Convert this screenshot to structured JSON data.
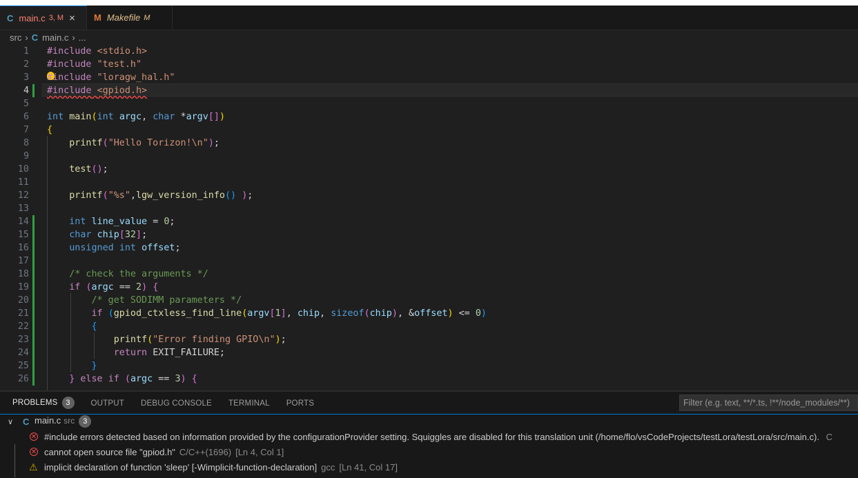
{
  "tabs": [
    {
      "icon": "C",
      "label": "main.c",
      "status": "3, M",
      "close": "×",
      "active": true
    },
    {
      "icon": "M",
      "label": "Makefile",
      "status": "M",
      "active": false
    }
  ],
  "breadcrumb": {
    "folder": "src",
    "icon": "C",
    "file": "main.c",
    "more": "..."
  },
  "editor": {
    "lines": [
      {
        "n": "1",
        "html": "<span class=\"p\">#include</span> <span class=\"s\">&lt;stdio.h&gt;</span>"
      },
      {
        "n": "2",
        "html": "<span class=\"p\">#include</span> <span class=\"s\">\"test.h\"</span>"
      },
      {
        "n": "3",
        "html": "<span class=\"p\">#include</span> <span class=\"s\">\"loragw_hal.h\"</span>"
      },
      {
        "n": "4",
        "html": "<span class=\"squiggle\"><span class=\"p\">#include</span> <span class=\"s\">&lt;gpiod.h&gt;</span></span>"
      },
      {
        "n": "5",
        "html": ""
      },
      {
        "n": "6",
        "html": "<span class=\"k\">int</span> <span class=\"f\">main</span><span class=\"b1\">(</span><span class=\"k\">int</span> <span class=\"v\">argc</span><span class=\"t\">, </span><span class=\"k\">char</span> <span class=\"t\">*</span><span class=\"v\">argv</span><span class=\"b2\">[]</span><span class=\"b1\">)</span>"
      },
      {
        "n": "7",
        "html": "<span class=\"b1\">{</span>"
      },
      {
        "n": "8",
        "html": "    <span class=\"f\">printf</span><span class=\"b2\">(</span><span class=\"s\">\"Hello Torizon!</span><span class=\"s\">\\n</span><span class=\"s\">\"</span><span class=\"b2\">)</span><span class=\"t\">;</span>"
      },
      {
        "n": "9",
        "html": ""
      },
      {
        "n": "10",
        "html": "    <span class=\"f\">test</span><span class=\"b2\">()</span><span class=\"t\">;</span>"
      },
      {
        "n": "11",
        "html": ""
      },
      {
        "n": "12",
        "html": "    <span class=\"f\">printf</span><span class=\"b2\">(</span><span class=\"s\">\"%s\"</span><span class=\"t\">,</span><span class=\"f\">lgw_version_info</span><span class=\"b3\">()</span> <span class=\"b2\">)</span><span class=\"t\">;</span>"
      },
      {
        "n": "13",
        "html": ""
      },
      {
        "n": "14",
        "html": "    <span class=\"k\">int</span> <span class=\"v\">line_value</span> <span class=\"t\">= </span><span class=\"n\">0</span><span class=\"t\">;</span>"
      },
      {
        "n": "15",
        "html": "    <span class=\"k\">char</span> <span class=\"v\">chip</span><span class=\"b2\">[</span><span class=\"n\">32</span><span class=\"b2\">]</span><span class=\"t\">;</span>"
      },
      {
        "n": "16",
        "html": "    <span class=\"k\">unsigned</span> <span class=\"k\">int</span> <span class=\"v\">offset</span><span class=\"t\">;</span>"
      },
      {
        "n": "17",
        "html": ""
      },
      {
        "n": "18",
        "html": "    <span class=\"c\">/* check the arguments */</span>"
      },
      {
        "n": "19",
        "html": "    <span class=\"p\">if</span> <span class=\"b2\">(</span><span class=\"v\">argc</span> <span class=\"t\">== </span><span class=\"n\">2</span><span class=\"b2\">)</span> <span class=\"b2\">{</span>"
      },
      {
        "n": "20",
        "html": "        <span class=\"c\">/* get SODIMM parameters */</span>"
      },
      {
        "n": "21",
        "html": "        <span class=\"p\">if</span> <span class=\"b3\">(</span><span class=\"f\">gpiod_ctxless_find_line</span><span class=\"b1\">(</span><span class=\"v\">argv</span><span class=\"b2\">[</span><span class=\"n\">1</span><span class=\"b2\">]</span><span class=\"t\">, </span><span class=\"v\">chip</span><span class=\"t\">, </span><span class=\"k\">sizeof</span><span class=\"b2\">(</span><span class=\"v\">chip</span><span class=\"b2\">)</span><span class=\"t\">, &amp;</span><span class=\"v\">offset</span><span class=\"b1\">)</span> <span class=\"t\">&lt;= </span><span class=\"n\">0</span><span class=\"b3\">)</span>"
      },
      {
        "n": "22",
        "html": "        <span class=\"b3\">{</span>"
      },
      {
        "n": "23",
        "html": "            <span class=\"f\">printf</span><span class=\"b1\">(</span><span class=\"s\">\"Error finding GPIO</span><span class=\"s\">\\n</span><span class=\"s\">\"</span><span class=\"b1\">)</span><span class=\"t\">;</span>"
      },
      {
        "n": "24",
        "html": "            <span class=\"p\">return</span> <span class=\"t\">EXIT_FAILURE;</span>"
      },
      {
        "n": "25",
        "html": "        <span class=\"b3\">}</span>"
      },
      {
        "n": "26",
        "html": "    <span class=\"b2\">}</span> <span class=\"p\">else</span> <span class=\"p\">if</span> <span class=\"b2\">(</span><span class=\"v\">argc</span> <span class=\"t\">== </span><span class=\"n\">3</span><span class=\"b2\">)</span> <span class=\"b2\">{</span>"
      }
    ]
  },
  "panel": {
    "tabs": [
      {
        "label": "PROBLEMS",
        "badge": "3",
        "active": true
      },
      {
        "label": "OUTPUT"
      },
      {
        "label": "DEBUG CONSOLE"
      },
      {
        "label": "TERMINAL"
      },
      {
        "label": "PORTS"
      }
    ],
    "filter_placeholder": "Filter (e.g. text, **/*.ts, !**/node_modules/**)",
    "file": {
      "icon": "C",
      "name": "main.c",
      "dir": "src",
      "count": "3"
    },
    "problems": [
      {
        "severity": "error",
        "text": "#include errors detected based on information provided by the configurationProvider setting. Squiggles are disabled for this translation unit (/home/flo/vsCodeProjects/testLora/testLora/src/main.c).",
        "source": "C",
        "loc": ""
      },
      {
        "severity": "error",
        "text": "cannot open source file \"gpiod.h\"",
        "source": "C/C++(1696)",
        "loc": "[Ln 4, Col 1]"
      },
      {
        "severity": "warning",
        "text": "implicit declaration of function 'sleep' [-Wimplicit-function-declaration]",
        "source": "gcc",
        "loc": "[Ln 41, Col 17]"
      }
    ]
  }
}
